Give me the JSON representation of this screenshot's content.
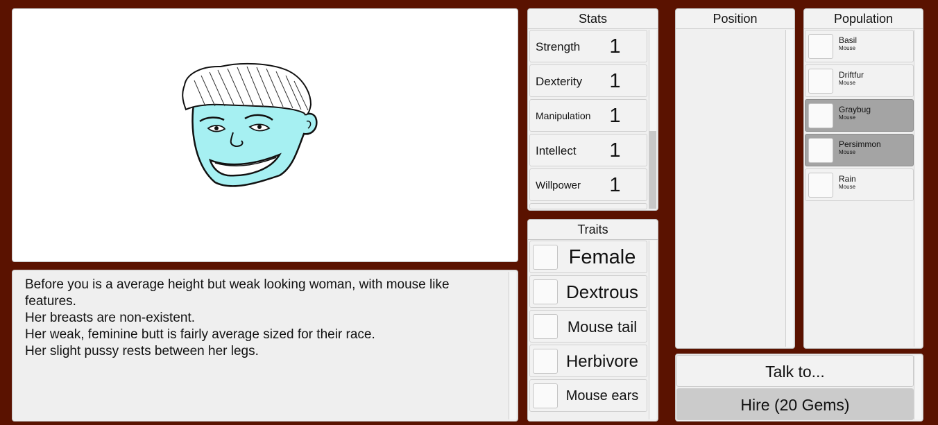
{
  "description": {
    "lines": [
      "Before you is a average height but weak looking woman, with mouse like",
      "features.",
      "Her breasts are non-existent.",
      "Her weak, feminine butt is fairly average sized for their race.",
      "Her slight pussy rests between her legs."
    ]
  },
  "stats": {
    "header": "Stats",
    "items": [
      {
        "name": "Strength",
        "value": "1"
      },
      {
        "name": "Dexterity",
        "value": "1"
      },
      {
        "name": "Manipulation",
        "value": "1"
      },
      {
        "name": "Intellect",
        "value": "1"
      },
      {
        "name": "Willpower",
        "value": "1"
      }
    ]
  },
  "traits": {
    "header": "Traits",
    "items": [
      {
        "label": "Female"
      },
      {
        "label": "Dextrous"
      },
      {
        "label": "Mouse tail"
      },
      {
        "label": "Herbivore"
      },
      {
        "label": "Mouse ears"
      }
    ]
  },
  "position": {
    "header": "Position"
  },
  "population": {
    "header": "Population",
    "items": [
      {
        "name": "Basil",
        "race": "Mouse",
        "selected": false
      },
      {
        "name": "Driftfur",
        "race": "Mouse",
        "selected": false
      },
      {
        "name": "Graybug",
        "race": "Mouse",
        "selected": true
      },
      {
        "name": "Persimmon",
        "race": "Mouse",
        "selected": true
      },
      {
        "name": "Rain",
        "race": "Mouse",
        "selected": false
      }
    ]
  },
  "actions": {
    "talk_label": "Talk to...",
    "hire_label": "Hire (20 Gems)"
  },
  "colors": {
    "background": "#5a1200",
    "skin": "#a6f0f2",
    "selected_row": "#a4a4a4"
  },
  "portrait": {
    "icon": "character-face-icon"
  }
}
